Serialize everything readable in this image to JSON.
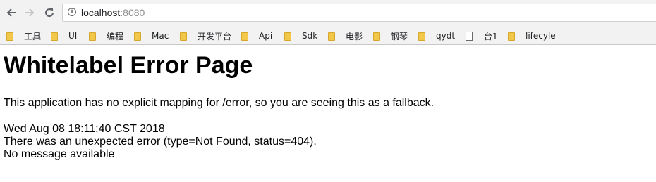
{
  "browser": {
    "url_host": "localhost",
    "url_port": ":8080",
    "info_icon_glyph": "i"
  },
  "bookmarks": [
    {
      "label": "工具",
      "icon": "folder-icon"
    },
    {
      "label": "UI",
      "icon": "folder-icon"
    },
    {
      "label": "编程",
      "icon": "folder-icon"
    },
    {
      "label": "Mac",
      "icon": "folder-icon"
    },
    {
      "label": "开发平台",
      "icon": "folder-icon"
    },
    {
      "label": "Api",
      "icon": "folder-icon"
    },
    {
      "label": "Sdk",
      "icon": "folder-icon"
    },
    {
      "label": "电影",
      "icon": "folder-icon"
    },
    {
      "label": "钢琴",
      "icon": "folder-icon"
    },
    {
      "label": "qydt",
      "icon": "folder-icon"
    },
    {
      "label": "台1",
      "icon": "page-icon"
    },
    {
      "label": "lifecyle",
      "icon": "folder-icon"
    }
  ],
  "page": {
    "title": "Whitelabel Error Page",
    "description": "This application has no explicit mapping for /error, so you are seeing this as a fallback.",
    "timestamp": "Wed Aug 08 18:11:40 CST 2018",
    "error_line": "There was an unexpected error (type=Not Found, status=404).",
    "message": "No message available"
  }
}
